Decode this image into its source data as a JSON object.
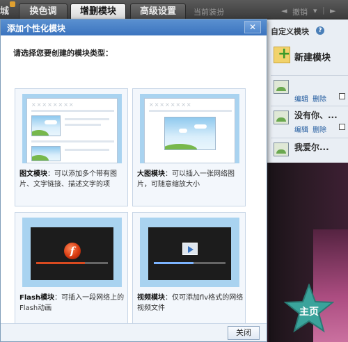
{
  "topbar": {
    "lead_label": "城",
    "tabs": [
      {
        "label": "换色调",
        "active": false
      },
      {
        "label": "增删模块",
        "active": true
      },
      {
        "label": "高级设置",
        "active": false
      }
    ],
    "current_dress": "当前装扮",
    "undo": "撤销",
    "undo_arrow": "◄",
    "redo_arrow": "►",
    "dropdown": "▾",
    "separator": "|"
  },
  "right_panel": {
    "title": "自定义模块",
    "help": "?",
    "new_module": "新建模块",
    "modules": [
      {
        "title": "",
        "edit": "编辑",
        "delete": "删除"
      },
      {
        "title": "没有你、...",
        "edit": "编辑",
        "delete": "删除"
      },
      {
        "title": "我爱尔...",
        "edit": "",
        "delete": ""
      }
    ]
  },
  "dialog": {
    "title": "添加个性化模块",
    "close_x": "✕",
    "prompt": "请选择您要创建的模块类型：",
    "xs": "××××××××",
    "cards": [
      {
        "name": "图文模块",
        "desc": "：可以添加多个带有图片、文字链接、描述文字的项"
      },
      {
        "name": "大图模块",
        "desc": "：可以插入一张网络图片，可随意缩放大小"
      },
      {
        "name": "Flash模块",
        "desc": "：可插入一段网络上的Flash动画"
      },
      {
        "name": "视频模块",
        "desc": "：仅可添加flv格式的网络视频文件"
      }
    ],
    "flash_glyph": "f",
    "close_button": "关闭"
  },
  "media": {
    "flash_progress": 0.68,
    "video_progress": 0.55
  },
  "home_star": {
    "label": "主页",
    "color": "#3aa39b"
  }
}
